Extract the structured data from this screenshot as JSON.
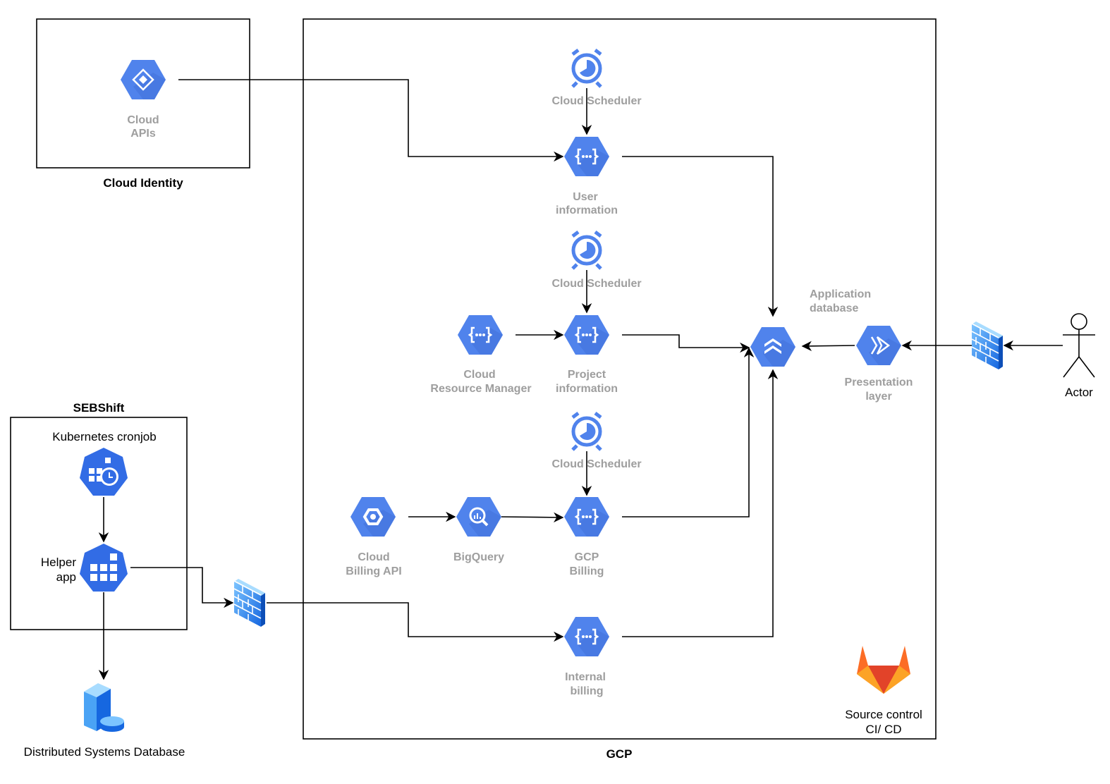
{
  "colors": {
    "gcp_blue": "#5083ec",
    "k8s_blue": "#326ce5",
    "firewall_blue": "#3b8ef0",
    "gitlab_orange": "#fc6d26"
  },
  "groups": {
    "cloud_identity": "Cloud Identity",
    "gcp": "GCP",
    "sebshift": "SEBShift"
  },
  "nodes": {
    "cloud_apis": {
      "line1": "Cloud",
      "line2": "APIs",
      "icon": "cloud-apis-icon"
    },
    "scheduler_1": {
      "label": "Cloud Scheduler",
      "icon": "cloud-scheduler-icon"
    },
    "user_info": {
      "line1": "User",
      "line2": "information",
      "icon": "cloud-functions-icon"
    },
    "scheduler_2": {
      "label": "Cloud Scheduler",
      "icon": "cloud-scheduler-icon"
    },
    "resource_manager": {
      "line1": "Cloud",
      "line2": "Resource Manager",
      "icon": "cloud-functions-icon"
    },
    "project_info": {
      "line1": "Project",
      "line2": "information",
      "icon": "cloud-functions-icon"
    },
    "scheduler_3": {
      "label": "Cloud Scheduler",
      "icon": "cloud-scheduler-icon"
    },
    "billing_api": {
      "line1": "Cloud",
      "line2": "Billing API",
      "icon": "cloud-billing-icon"
    },
    "bigquery": {
      "label": "BigQuery",
      "icon": "bigquery-icon"
    },
    "gcp_billing": {
      "line1": "GCP",
      "line2": "Billing",
      "icon": "cloud-functions-icon"
    },
    "internal_billing": {
      "line1": "Internal",
      "line2": "billing",
      "icon": "cloud-functions-icon"
    },
    "app_db": {
      "line1": "Application",
      "line2": "database",
      "icon": "firestore-icon"
    },
    "presentation": {
      "line1": "Presentation",
      "line2": "layer",
      "icon": "cloud-run-icon"
    },
    "actor": {
      "label": "Actor",
      "icon": "actor-icon"
    },
    "gitlab": {
      "line1": "Source control",
      "line2": "CI/ CD",
      "icon": "gitlab-icon"
    },
    "cronjob": {
      "label": "Kubernetes cronjob",
      "icon": "kubernetes-cronjob-icon"
    },
    "helper": {
      "line1": "Helper",
      "line2": "app",
      "icon": "kubernetes-deployment-icon"
    },
    "dsdb": {
      "label": "Distributed Systems Database",
      "icon": "database-server-icon"
    }
  }
}
